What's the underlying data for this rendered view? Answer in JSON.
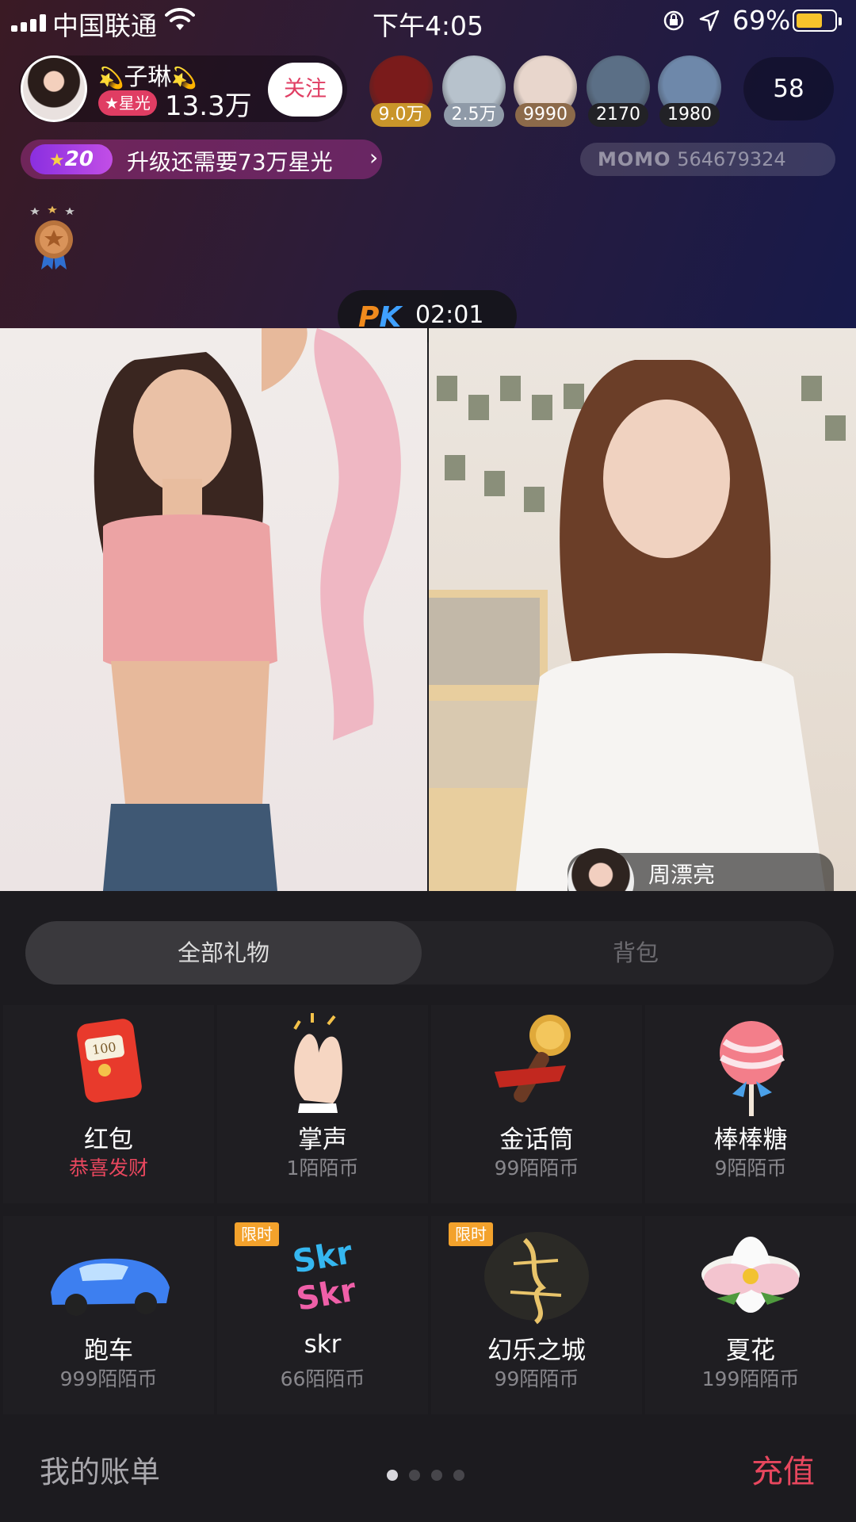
{
  "status_bar": {
    "carrier": "中国联通",
    "time": "下午4:05",
    "battery_percent": "69%",
    "battery_level": 0.69
  },
  "host": {
    "name": "子琳",
    "sparkle_left": "💫",
    "sparkle_right": "💫",
    "star_label": "★星光",
    "star_count": "13.3万",
    "follow_label": "关注"
  },
  "viewers": [
    {
      "amount": "9.0万",
      "badge_color": "#c9952a",
      "avatar_color": "#7a1b1b"
    },
    {
      "amount": "2.5万",
      "badge_color": "#8f9aa8",
      "avatar_color": "#b7c2cc"
    },
    {
      "amount": "9990",
      "badge_color": "#8c6a4a",
      "avatar_color": "#e8d6cc"
    },
    {
      "amount": "2170",
      "badge_color": "#222226",
      "avatar_color": "#5b6f86"
    },
    {
      "amount": "1980",
      "badge_color": "#222226",
      "avatar_color": "#6e88aa"
    }
  ],
  "online_count": "58",
  "level": {
    "badge": "20",
    "progress_text": "升级还需要73万星光",
    "chevron": "›"
  },
  "momo": {
    "label": "MOMO",
    "id": "564679324"
  },
  "pk": {
    "logo_p": "P",
    "logo_k": "K",
    "timer": "02:01"
  },
  "opponent": {
    "name": "周漂亮"
  },
  "gift_tabs": {
    "all": "全部礼物",
    "bag": "背包"
  },
  "gifts": [
    {
      "name": "红包",
      "price": "恭喜发财",
      "icon": "red-envelope-icon"
    },
    {
      "name": "掌声",
      "price": "1陌陌币",
      "icon": "clapping-hands-icon"
    },
    {
      "name": "金话筒",
      "price": "99陌陌币",
      "icon": "golden-microphone-icon"
    },
    {
      "name": "棒棒糖",
      "price": "9陌陌币",
      "icon": "lollipop-icon"
    },
    {
      "name": "跑车",
      "price": "999陌陌币",
      "icon": "sports-car-icon"
    },
    {
      "name": "skr",
      "price": "66陌陌币",
      "icon": "skr-icon",
      "tag": "限时"
    },
    {
      "name": "幻乐之城",
      "price": "99陌陌币",
      "icon": "fantasy-city-icon",
      "tag": "限时"
    },
    {
      "name": "夏花",
      "price": "199陌陌币",
      "icon": "summer-flower-icon"
    }
  ],
  "footer": {
    "bill_label": "我的账单",
    "recharge_label": "充值",
    "pages_total": 4,
    "page_current": 1
  }
}
